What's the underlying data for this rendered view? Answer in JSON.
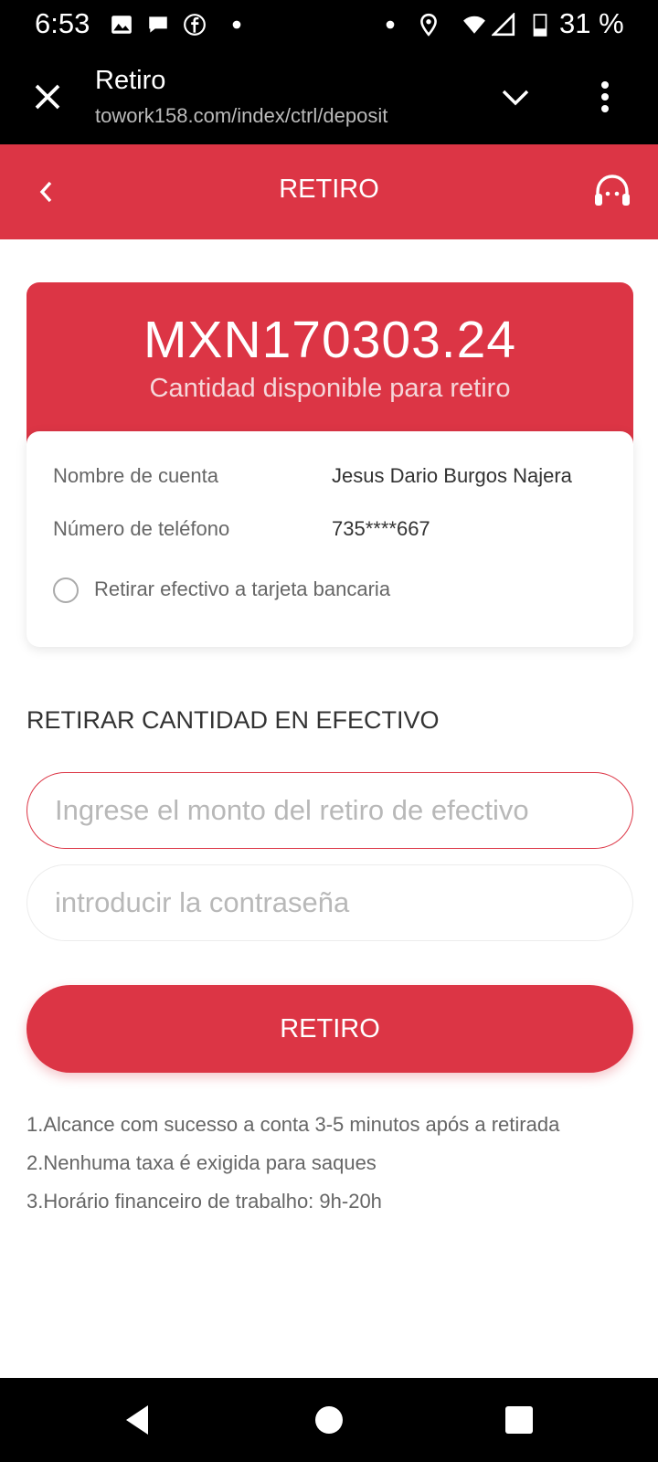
{
  "status_bar": {
    "time": "6:53",
    "battery": "31 %"
  },
  "browser": {
    "title": "Retiro",
    "url": "towork158.com/index/ctrl/deposit"
  },
  "header": {
    "title": "RETIRO"
  },
  "balance": {
    "amount": "MXN170303.24",
    "caption": "Cantidad disponible para retiro"
  },
  "account": {
    "name_label": "Nombre de cuenta",
    "name_value": "Jesus Dario Burgos Najera",
    "phone_label": "Número de teléfono",
    "phone_value": "735****667",
    "bank_option": "Retirar efectivo a tarjeta bancaria"
  },
  "form": {
    "section_title": "RETIRAR CANTIDAD EN EFECTIVO",
    "amount_placeholder": "Ingrese el monto del retiro de efectivo",
    "password_placeholder": "introducir la contraseña",
    "submit_label": "RETIRO"
  },
  "notes": [
    "1.Alcance com sucesso a conta 3-5 minutos após a retirada",
    "2.Nenhuma taxa é exigida para saques",
    "3.Horário financeiro de trabalho: 9h-20h"
  ],
  "colors": {
    "accent": "#dc3545",
    "bars": "#000000"
  }
}
